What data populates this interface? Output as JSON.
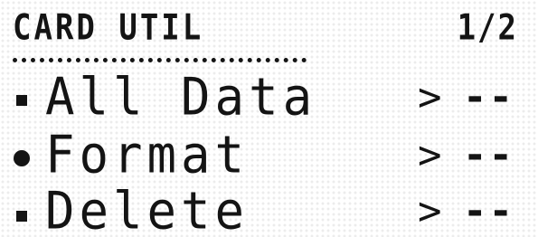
{
  "header": {
    "title": "CARD UTIL",
    "page_indicator": "1/2"
  },
  "menu": {
    "items": [
      {
        "label": "All Data",
        "arrow": ">",
        "value": "--",
        "selected": false
      },
      {
        "label": "Format",
        "arrow": ">",
        "value": "--",
        "selected": true
      },
      {
        "label": "Delete",
        "arrow": ">",
        "value": "--",
        "selected": false
      }
    ]
  },
  "colors": {
    "lcd_background": "#ffffff",
    "pixel_on": "#141414",
    "pixel_off": "#ececec"
  }
}
